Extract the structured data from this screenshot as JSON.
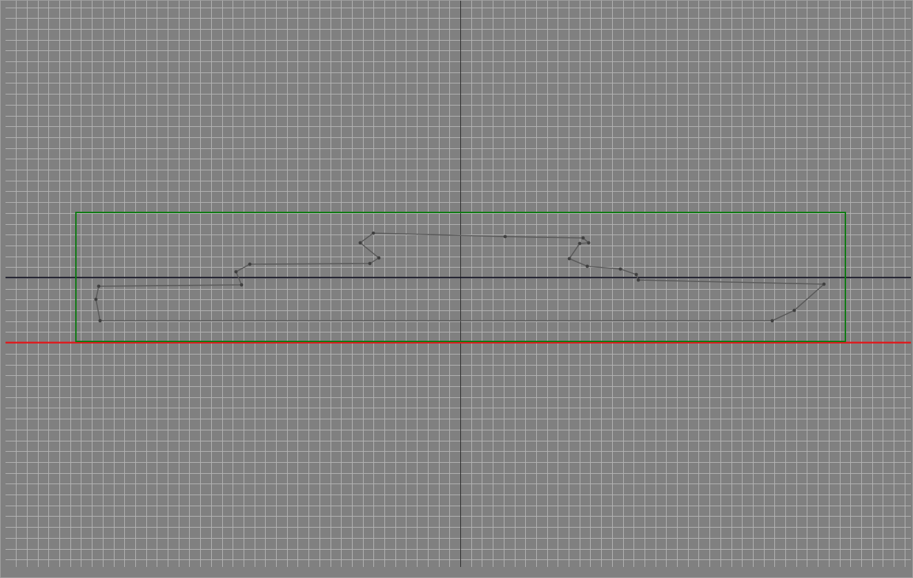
{
  "viewport": {
    "view": "front",
    "grid": "on",
    "colors": {
      "background": "#808080",
      "grid_line": "#b4b4b4",
      "grid_major": "#a6a6a6",
      "vertical_axis": "#2a2a2a",
      "horizontal_axis": "#101020",
      "ground_line": "#e0191c",
      "bounding_box": "#0d7a12",
      "shape_outline": "#5a5a5a",
      "vertex": "#404040",
      "border": "#a0a0a0"
    }
  }
}
